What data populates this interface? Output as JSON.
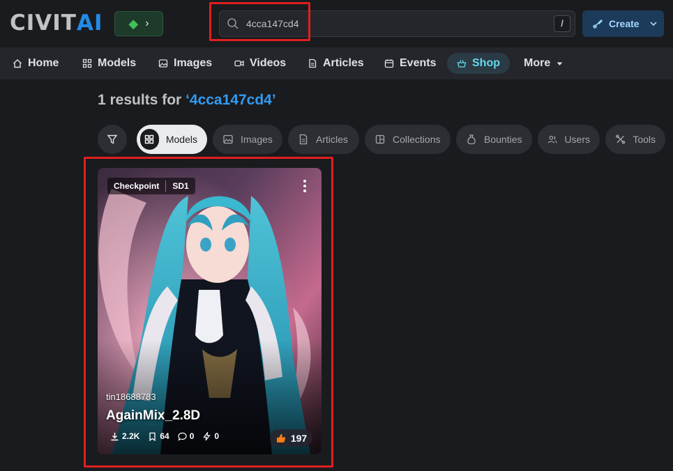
{
  "header": {
    "logo_main": "CIVIT",
    "logo_accent": "AI",
    "search": {
      "value": "4cca147cd4",
      "shortcut": "/"
    },
    "create_label": "Create"
  },
  "nav": {
    "items": [
      {
        "label": "Home",
        "icon": "home-icon"
      },
      {
        "label": "Models",
        "icon": "grid-icon"
      },
      {
        "label": "Images",
        "icon": "image-icon"
      },
      {
        "label": "Videos",
        "icon": "video-icon"
      },
      {
        "label": "Articles",
        "icon": "file-text-icon"
      },
      {
        "label": "Events",
        "icon": "calendar-icon"
      },
      {
        "label": "Shop",
        "icon": "basket-icon"
      },
      {
        "label": "More",
        "icon": "caret-down-icon"
      }
    ]
  },
  "results": {
    "prefix": "1 results for",
    "query": "‘4cca147cd4’"
  },
  "filters": [
    {
      "label": "Models",
      "active": true
    },
    {
      "label": "Images"
    },
    {
      "label": "Articles"
    },
    {
      "label": "Collections"
    },
    {
      "label": "Bounties"
    },
    {
      "label": "Users"
    },
    {
      "label": "Tools"
    }
  ],
  "card": {
    "type": "Checkpoint",
    "base": "SD1",
    "user": "tin18688783",
    "title": "AgainMix_2.8D",
    "downloads": "2.2K",
    "bookmarks": "64",
    "comments": "0",
    "buzz": "0",
    "likes": "197"
  },
  "colors": {
    "accent": "#228be6",
    "highlight": "#e01f1f",
    "shop": "#66d9e8"
  }
}
